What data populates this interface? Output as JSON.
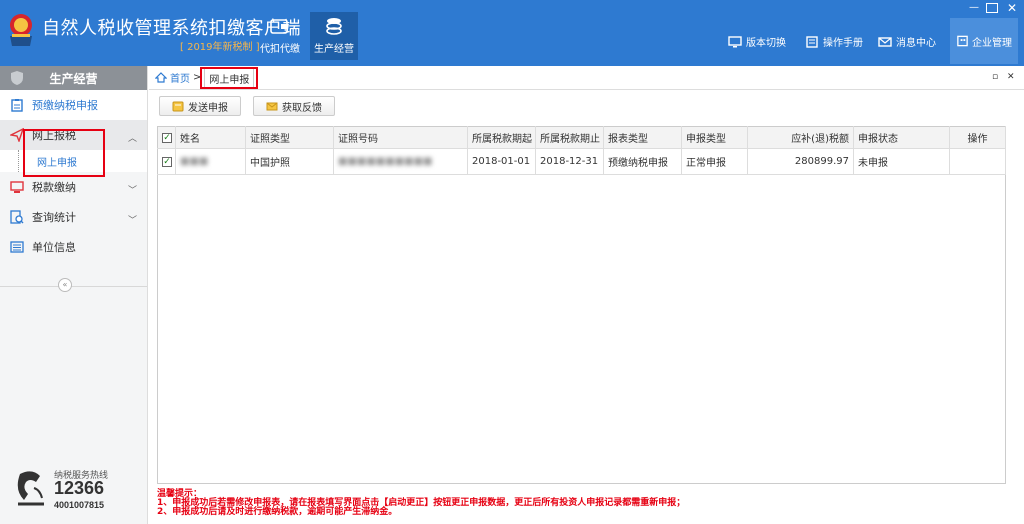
{
  "app": {
    "title": "自然人税收管理系统扣缴客户端",
    "subtitle": "[ 2019年新税制 ]",
    "nav_tabs": [
      {
        "label": "代扣代缴",
        "icon": "wallet-icon",
        "active": false
      },
      {
        "label": "生产经营",
        "icon": "coins-icon",
        "active": true
      }
    ],
    "top_right": [
      {
        "label": "版本切换",
        "icon": "monitor-icon"
      },
      {
        "label": "操作手册",
        "icon": "book-icon"
      },
      {
        "label": "消息中心",
        "icon": "mail-icon"
      }
    ],
    "enterprise_label": "企业管理",
    "colors": {
      "header": "#2e7ad1",
      "accent": "#2e7ad1",
      "highlight": "#e60012",
      "subtitle": "#f7b64b"
    }
  },
  "sidebar": {
    "title": "生产经营",
    "items": [
      {
        "label": "预缴纳税申报",
        "icon": "clipboard-icon"
      },
      {
        "label": "网上报税",
        "icon": "send-icon",
        "expanded": true
      },
      {
        "label": "税款缴纳",
        "icon": "screen-icon"
      },
      {
        "label": "查询统计",
        "icon": "search-doc-icon"
      },
      {
        "label": "单位信息",
        "icon": "list-icon"
      }
    ],
    "sub_item": "网上申报",
    "collapse_glyph": "«",
    "hotline": {
      "label": "纳税服务热线",
      "number": "12366",
      "sub": "4001007815"
    }
  },
  "breadcrumb": {
    "home": "首页",
    "separator": ">",
    "current": "网上申报"
  },
  "toolbar": {
    "send": "发送申报",
    "feedback": "获取反馈"
  },
  "table": {
    "headers": [
      "姓名",
      "证照类型",
      "证照号码",
      "所属税款期起",
      "所属税款期止",
      "报表类型",
      "申报类型",
      "应补(退)税额",
      "申报状态",
      "操作"
    ],
    "rows": [
      {
        "checked": true,
        "name": "■■■",
        "id_type": "中国护照",
        "id_number": "■■■■■■■■■■",
        "period_start": "2018-01-01",
        "period_end": "2018-12-31",
        "report_type": "预缴纳税申报",
        "declare_type": "正常申报",
        "tax": "280899.97",
        "status": "未申报",
        "action": ""
      }
    ]
  },
  "tips": {
    "title": "温馨提示：",
    "line1": "1、申报成功后若需修改申报表，请在报表填写界面点击【启动更正】按钮更正申报数据，更正后所有投资人申报记录都需重新申报；",
    "line2": "2、申报成功后请及时进行缴纳税款，逾期可能产生滞纳金。"
  }
}
